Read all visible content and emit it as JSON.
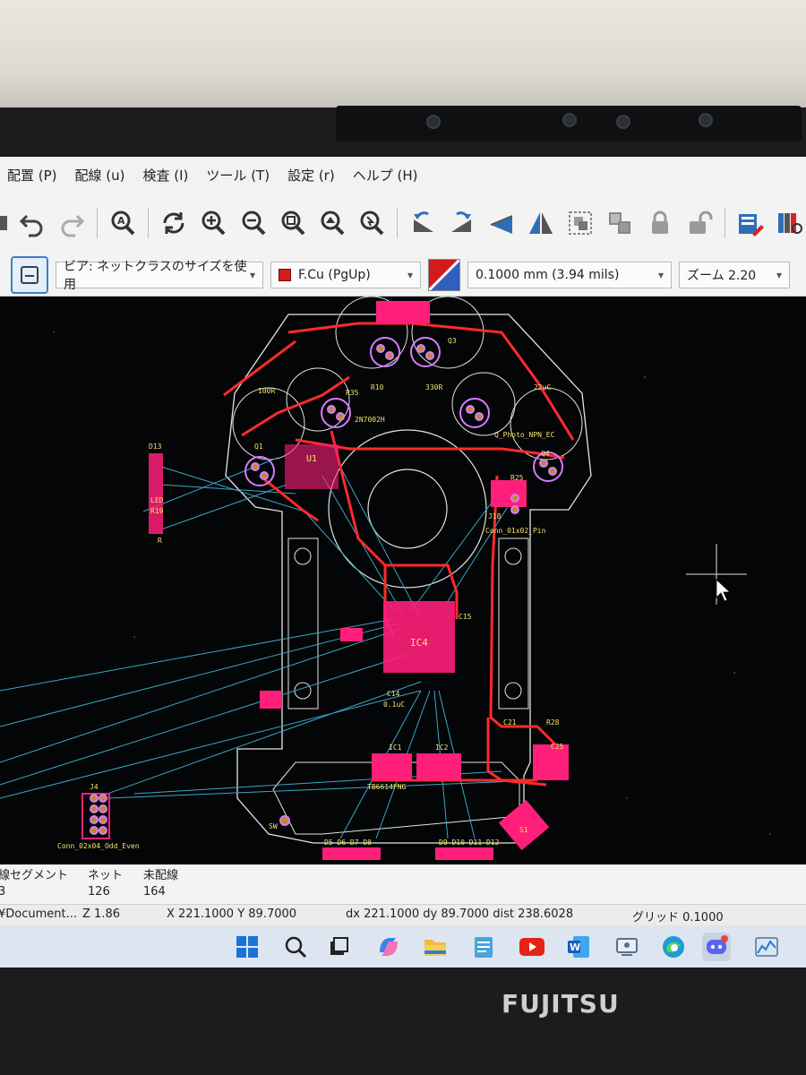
{
  "menu": {
    "items": [
      "配置 (P)",
      "配線 (u)",
      "検査 (I)",
      "ツール (T)",
      "設定 (r)",
      "ヘルプ (H)"
    ]
  },
  "toolbar": {
    "icons": [
      "save-icon",
      "undo-icon",
      "redo-icon",
      "find-icon",
      "refresh-icon",
      "zoom-in-icon",
      "zoom-out-icon",
      "zoom-fit-icon",
      "zoom-objects-icon",
      "zoom-selection-icon",
      "rotate-ccw-icon",
      "rotate-cw-icon",
      "flip-horizontal-icon",
      "mirror-icon",
      "group-icon",
      "ungroup-icon",
      "lock-icon",
      "unlock-icon",
      "netlist-update-icon",
      "library-browser-icon"
    ]
  },
  "options": {
    "via_size": "ビア: ネットクラスのサイズを使用",
    "layer": "F.Cu (PgUp)",
    "grid": "0.1000 mm (3.94 mils)",
    "zoom": "ズーム 2.20"
  },
  "pcb": {
    "labels": {
      "d13": "D13",
      "led": "LED",
      "r19": "R19",
      "r": "R",
      "u1": "U1",
      "q1": "Q1",
      "r10": "R10",
      "r35": "R35",
      "r330": "330R",
      "r100": "100R",
      "c22u": "22uC",
      "q3": "Q3",
      "q4": "Q4",
      "r25": "R25",
      "j18": "J18",
      "conn_pin": "Conn_01x02_Pin",
      "ic4": "IC4",
      "c15": "C15",
      "c01u": "0.1uC",
      "c14": "C14",
      "ic1": "IC1",
      "ic2": "IC2",
      "tb": "TB6614FNG",
      "j4": "J4",
      "conn_j4": "Conn_02x04_Odd_Even",
      "sw": "SW",
      "s1": "S1",
      "leds_left": "D5 D6 D7 D8",
      "leds_right": "D9 D10 D11 D12",
      "c21": "C21",
      "r28": "R28",
      "c25": "C25",
      "mos": "2N7002H",
      "photo": "Q_Photo_NPN_EC"
    }
  },
  "status": {
    "headers": {
      "segments": "線セグメント",
      "nets": "ネット",
      "unrouted": "未配線"
    },
    "values": {
      "segments": "3",
      "nets": "126",
      "unrouted": "164"
    },
    "path": "¥Document...",
    "zoom": "Z 1.86",
    "coords": "X 221.1000  Y 89.7000",
    "delta": "dx 221.1000  dy 89.7000  dist 238.6028",
    "grid": "グリッド 0.1000"
  },
  "taskbar": {
    "icons": [
      "windows-start-icon",
      "search-icon",
      "task-view-icon",
      "copilot-icon",
      "file-explorer-icon",
      "notepad-icon",
      "youtube-icon",
      "word-icon",
      "teams-icon",
      "edge-icon",
      "discord-icon",
      "performance-monitor-icon"
    ]
  },
  "brand": "FUJITSU",
  "colors": {
    "track_red": "#ff2a2a",
    "ratsnest": "#3aa6c6",
    "pad_pink": "#ff1f7a",
    "silk": "#f4e26b"
  }
}
